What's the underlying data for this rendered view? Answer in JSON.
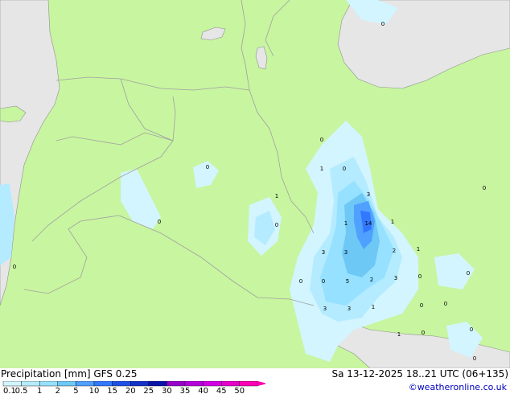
{
  "header": {
    "title": "Precipitation [mm]  GFS 0.25",
    "valid": "Sa 13-12-2025 18..21 UTC (06+135)",
    "credit": "©weatheronline.co.uk"
  },
  "legend": {
    "ticks": [
      "0.1",
      "0.5",
      "1",
      "2",
      "5",
      "10",
      "15",
      "20",
      "25",
      "30",
      "35",
      "40",
      "45",
      "50"
    ],
    "colors": [
      "#d2f5ff",
      "#b4ebff",
      "#96e1ff",
      "#6ec8f5",
      "#50a0ff",
      "#3278ff",
      "#1e50e6",
      "#1432c8",
      "#0a14aa",
      "#9600c8",
      "#b400dc",
      "#d200e6",
      "#e600c8",
      "#ff00b4"
    ]
  },
  "colors": {
    "land": "#c8f5a0",
    "sea": "#e6e6e6",
    "border": "#a0a0a0"
  },
  "value_labels": [
    "0",
    "0",
    "0",
    "1",
    "0",
    "0",
    "3",
    "1",
    "14",
    "1",
    "1",
    "3",
    "3",
    "2",
    "1",
    "0",
    "0",
    "0",
    "0",
    "5",
    "2",
    "3",
    "0",
    "0",
    "3",
    "3",
    "1",
    "0",
    "0",
    "0",
    "1",
    "0",
    "0",
    "0"
  ]
}
